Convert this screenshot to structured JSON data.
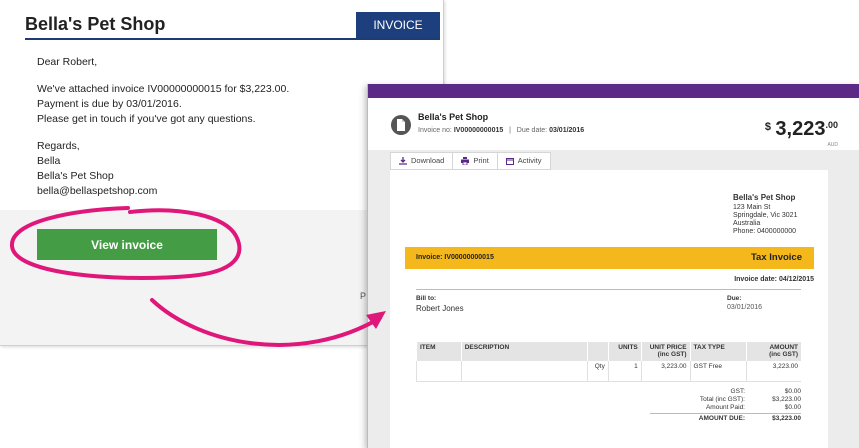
{
  "email": {
    "shop_name": "Bella's Pet Shop",
    "tab_label": "INVOICE",
    "greeting": "Dear Robert,",
    "line1": "We've attached invoice IV00000000015 for $3,223.00.",
    "line2": "Payment is due by 03/01/2016.",
    "line3": "Please get in touch if you've got any questions.",
    "regards": "Regards,",
    "name": "Bella",
    "shop": "Bella's Pet Shop",
    "email_address": "bella@bellaspetshop.com",
    "button_label": "View invoice",
    "cut_text": "P"
  },
  "invoice": {
    "shop_name": "Bella's Pet Shop",
    "invoice_no_label": "Invoice no:",
    "invoice_no": "IV00000000015",
    "separator": "|",
    "due_date_label": "Due date:",
    "due_date": "03/01/2016",
    "currency_symbol": "$",
    "amount_whole": "3,223",
    "amount_cents": ".00",
    "currency_code": "AUD",
    "toolbar": {
      "download": "Download",
      "print": "Print",
      "activity": "Activity"
    },
    "from": {
      "name": "Bella's Pet Shop",
      "street": "123 Main St",
      "city": "Springdale, Vic 3021",
      "country": "Australia",
      "phone": "Phone: 0400000000"
    },
    "bar_invoice": "Invoice: IV00000000015",
    "bar_title": "Tax Invoice",
    "invoice_date_label": "Invoice date:",
    "invoice_date": "04/12/2015",
    "bill_to_label": "Bill to:",
    "bill_to_name": "Robert Jones",
    "due_label": "Due:",
    "due_value": "03/01/2016",
    "table": {
      "headers": {
        "item": "ITEM",
        "description": "DESCRIPTION",
        "units": "UNITS",
        "unit_price": "UNIT PRICE",
        "unit_price_sub": "(inc GST)",
        "tax_type": "TAX TYPE",
        "amount": "AMOUNT",
        "amount_sub": "(inc GST)"
      },
      "row": {
        "item": "",
        "description": "",
        "qty_label": "Qty",
        "units": "1",
        "unit_price": "3,223.00",
        "tax_type": "GST Free",
        "amount": "3,223.00"
      }
    },
    "totals": {
      "gst_label": "GST:",
      "gst_value": "$0.00",
      "total_label": "Total (inc GST):",
      "total_value": "$3,223.00",
      "paid_label": "Amount Paid:",
      "paid_value": "$0.00",
      "due_label": "AMOUNT DUE:",
      "due_value": "$3,223.00"
    }
  },
  "colors": {
    "header_blue": "#1e3f7d",
    "button_green": "#449d44",
    "annotation_magenta": "#e0177a",
    "topbar_purple": "#5b2a86",
    "bar_yellow": "#f5b81c"
  }
}
